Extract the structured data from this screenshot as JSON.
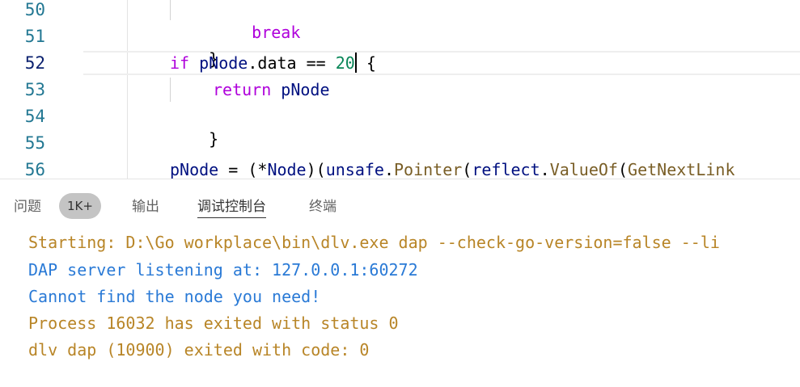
{
  "editor": {
    "lines": [
      {
        "number": "50",
        "keyword": "break"
      },
      {
        "number": "51",
        "text": "}"
      },
      {
        "number": "52",
        "kw": "if",
        "ident": "pNode",
        "field": ".data == ",
        "num": "20",
        "after": " {"
      },
      {
        "number": "53",
        "keyword": "return",
        "ident": "pNode"
      },
      {
        "number": "54",
        "text": "}"
      },
      {
        "number": "55",
        "text": ""
      },
      {
        "number": "56",
        "ident": "pNode",
        "op": " = (*",
        "type": "Node",
        "op2": ")(",
        "pkg": "unsafe",
        "dot": ".",
        "fn": "Pointer",
        "paren": "(",
        "pkg2": "reflect",
        "dot2": ".",
        "fn2": "ValueOf",
        "paren2": "(",
        "fn3": "GetNextLink"
      }
    ]
  },
  "panel": {
    "tabs": [
      {
        "label": "问题"
      },
      {
        "label": "输出"
      },
      {
        "label": "调试控制台"
      },
      {
        "label": "终端"
      }
    ],
    "problems_badge": "1K+",
    "active_tab": "调试控制台",
    "console_lines": [
      {
        "text": "Starting: D:\\Go workplace\\bin\\dlv.exe dap --check-go-version=false --li",
        "color": "#b88527"
      },
      {
        "text": "DAP server listening at: 127.0.0.1:60272",
        "color": "#2a7ad6"
      },
      {
        "text": "Cannot find the node you need!",
        "color": "#2a7ad6"
      },
      {
        "text": "Process 16032 has exited with status 0",
        "color": "#b88527"
      },
      {
        "text": "dlv dap (10900) exited with code: 0",
        "color": "#b88527"
      }
    ]
  }
}
